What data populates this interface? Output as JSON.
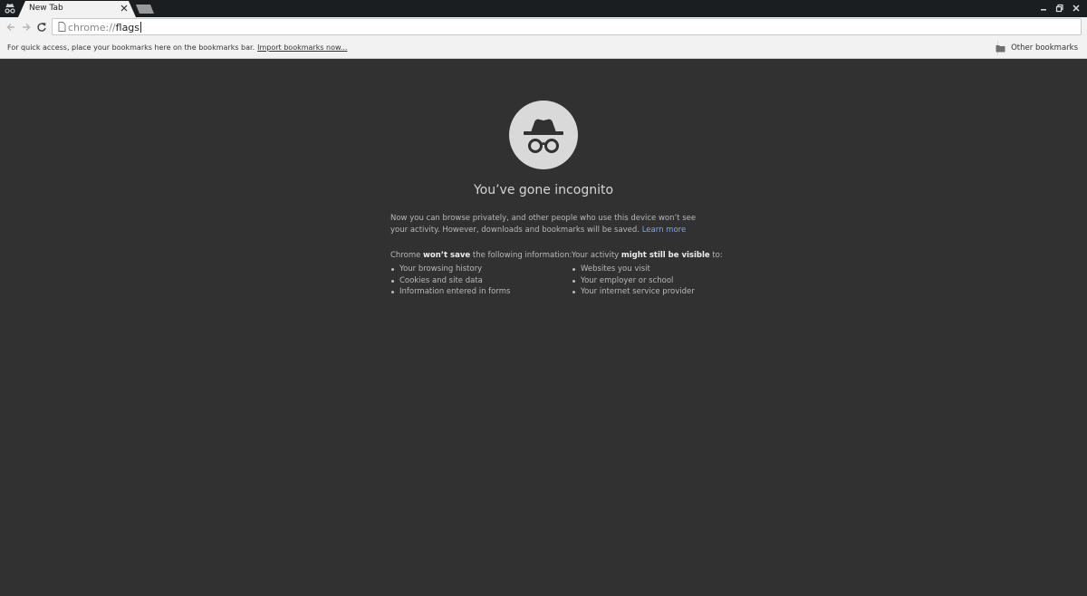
{
  "tab": {
    "title": "New Tab"
  },
  "omnibox": {
    "scheme": "chrome://",
    "path": "flags"
  },
  "bookmarks_bar": {
    "hint": "For quick access, place your bookmarks here on the bookmarks bar.",
    "import_link": "Import bookmarks now...",
    "other_bookmarks": "Other bookmarks"
  },
  "incognito_page": {
    "title": "You’ve gone incognito",
    "intro": "Now you can browse privately, and other people who use this device won’t see your activity. However, downloads and bookmarks will be saved.",
    "learn_more": "Learn more",
    "wont_save": {
      "prefix": "Chrome",
      "emphasis": "won’t save",
      "suffix": "the following information:",
      "items": [
        "Your browsing history",
        "Cookies and site data",
        "Information entered in forms"
      ]
    },
    "might_be_visible": {
      "prefix": "Your activity",
      "emphasis": "might still be visible",
      "suffix": "to:",
      "items": [
        "Websites you visit",
        "Your employer or school",
        "Your internet service provider"
      ]
    }
  },
  "icons": [
    "incognito-icon",
    "close-icon",
    "back-icon",
    "forward-icon",
    "reload-icon",
    "page-icon",
    "folder-icon",
    "minimize-icon",
    "maximize-icon",
    "window-close-icon"
  ],
  "colors": {
    "content_background": "#313131",
    "tabstrip_background": "#1b1e20",
    "toolbar_background": "#f2f2f2",
    "link": "#7fa8f3"
  }
}
